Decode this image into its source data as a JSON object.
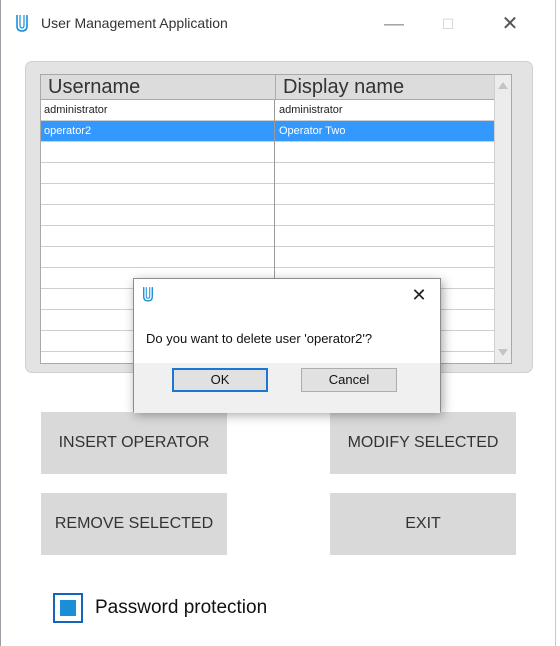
{
  "window": {
    "title": "User Management Application",
    "icon": "app-icon",
    "controls": {
      "minimize": "—",
      "maximize": "☐",
      "close": "✕"
    }
  },
  "grid": {
    "columns": [
      "Username",
      "Display name"
    ],
    "rows": [
      {
        "username": "administrator",
        "display_name": "administrator",
        "selected": false
      },
      {
        "username": "operator2",
        "display_name": "Operator Two",
        "selected": true
      }
    ],
    "selection_color": "#3399ff"
  },
  "buttons": {
    "insert": "INSERT OPERATOR",
    "modify": "MODIFY SELECTED",
    "remove": "REMOVE SELECTED",
    "exit": "EXIT"
  },
  "password_protection": {
    "label": "Password protection",
    "checked": true,
    "color": "#1a8fd8"
  },
  "dialog": {
    "message": "Do you want to delete user 'operator2'?",
    "ok_label": "OK",
    "cancel_label": "Cancel",
    "close": "✕"
  }
}
